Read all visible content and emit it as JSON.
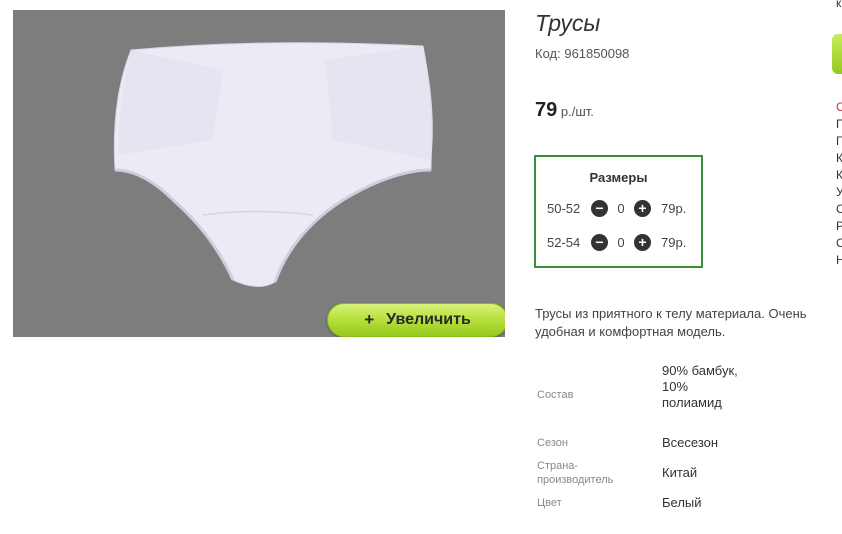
{
  "product": {
    "title": "Трусы",
    "code_label": "Код:",
    "code": "961850098",
    "price_value": "79",
    "price_unit": "р./шт.",
    "zoom_button": "Увеличить",
    "zoom_plus": "+"
  },
  "sizes": {
    "title": "Размеры",
    "rows": [
      {
        "size": "50-52",
        "qty": "0",
        "price": "79р."
      },
      {
        "size": "52-54",
        "qty": "0",
        "price": "79р."
      }
    ],
    "minus_symbol": "−",
    "plus_symbol": "+"
  },
  "description": "Трусы из приятного к телу материала. Очень удобная и комфортная модель.",
  "attributes": [
    {
      "label": "Состав",
      "value": "90% бамбук, 10% полиамид"
    },
    {
      "label": "Сезон",
      "value": "Всесезон"
    },
    {
      "label": "Страна-производитель",
      "value": "Китай"
    },
    {
      "label": "Цвет",
      "value": "Белый"
    }
  ],
  "right_edge_letters": [
    "к",
    "С",
    "П",
    "Г",
    "К",
    "К",
    "У",
    "С",
    "Р",
    "С",
    "Н"
  ],
  "colors": {
    "accent_green": "#96c81f",
    "sizes_border": "#3a8f3a",
    "photo_bg": "#7e7d7e"
  }
}
